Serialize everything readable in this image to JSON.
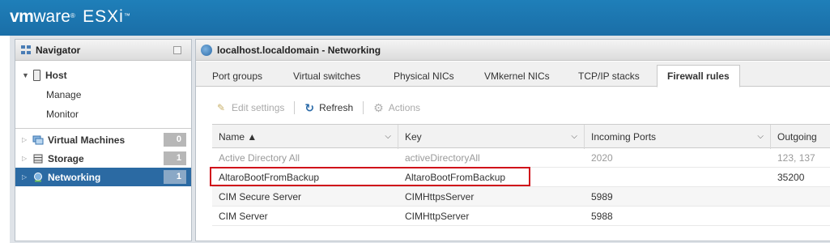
{
  "banner": {
    "brand_vm": "vm",
    "brand_ware": "ware",
    "brand_reg": "®",
    "product": "ESXi",
    "trademark": "™"
  },
  "navigator": {
    "title": "Navigator",
    "host": {
      "label": "Host",
      "children": [
        "Manage",
        "Monitor"
      ]
    },
    "items": [
      {
        "label": "Virtual Machines",
        "count": "0",
        "icon": "vm-icon"
      },
      {
        "label": "Storage",
        "count": "1",
        "icon": "storage-icon"
      },
      {
        "label": "Networking",
        "count": "1",
        "icon": "network-icon",
        "selected": true
      }
    ]
  },
  "content": {
    "title": "localhost.localdomain - Networking",
    "tabs": [
      "Port groups",
      "Virtual switches",
      "Physical NICs",
      "VMkernel NICs",
      "TCP/IP stacks",
      "Firewall rules"
    ],
    "active_tab": "Firewall rules",
    "toolbar": {
      "edit_settings": "Edit settings",
      "refresh": "Refresh",
      "actions": "Actions"
    },
    "grid": {
      "columns": [
        "Name ▲",
        "Key",
        "Incoming Ports",
        "Outgoing"
      ],
      "rows": [
        {
          "name": "Active Directory All",
          "key": "activeDirectoryAll",
          "incoming": "2020",
          "outgoing": "123, 137",
          "dim": true
        },
        {
          "name": "AltaroBootFromBackup",
          "key": "AltaroBootFromBackup",
          "incoming": "",
          "outgoing": "35200",
          "highlighted": true
        },
        {
          "name": "CIM Secure Server",
          "key": "CIMHttpsServer",
          "incoming": "5989",
          "outgoing": ""
        },
        {
          "name": "CIM Server",
          "key": "CIMHttpServer",
          "incoming": "5988",
          "outgoing": ""
        }
      ]
    }
  },
  "colors": {
    "banner": "#1f7fb9",
    "selected_nav": "#2b6aa3",
    "highlight": "#d0101a"
  }
}
